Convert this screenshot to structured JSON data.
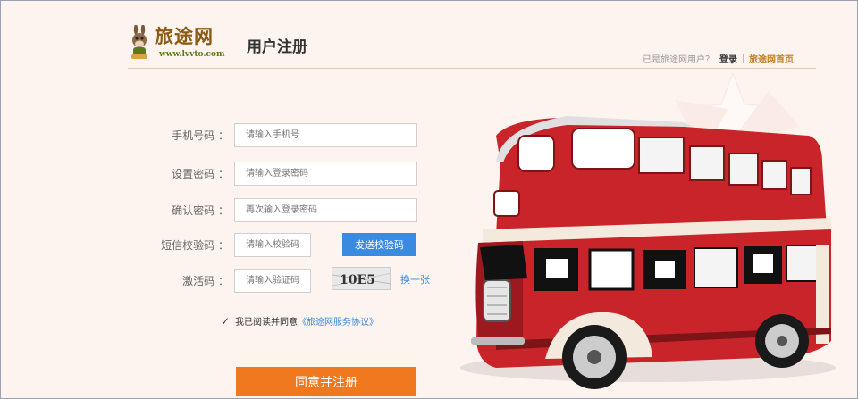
{
  "header": {
    "logo_text": "旅途网",
    "logo_url": "www.lvvto.com",
    "title": "用户注册",
    "existing_user_text": "已是旅途网用户？",
    "login_label": "登录",
    "home_label": "旅途网首页"
  },
  "form": {
    "phone_label": "手机号码 ：",
    "phone_placeholder": "请输入手机号",
    "password_label": "设置密码 ：",
    "password_placeholder": "请输入登录密码",
    "confirm_label": "确认密码 ：",
    "confirm_placeholder": "再次输入登录密码",
    "sms_label": "短信校验码 ：",
    "sms_placeholder": "请输入校验码",
    "sms_button": "发送校验码",
    "activation_label": "激活码 ：",
    "activation_placeholder": "请输入验证码",
    "captcha_text": "10E5",
    "swap_label": "换一张",
    "agree_text": "我已阅读并同意",
    "agree_link": "《旅途网服务协议》",
    "submit_label": "同意并注册"
  },
  "colors": {
    "accent_blue": "#3a8be0",
    "accent_orange": "#f0781e",
    "bus_red": "#c8242a",
    "background": "#fdf3ef"
  }
}
